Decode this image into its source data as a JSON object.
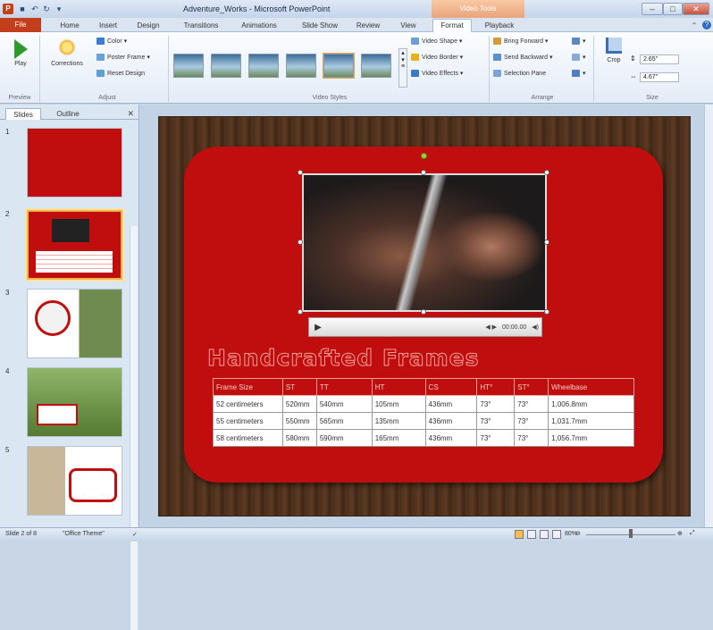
{
  "window": {
    "title": "Adventure_Works - Microsoft PowerPoint",
    "context_tab": "Video Tools",
    "app_icon": "P",
    "quick_access": [
      "save-icon",
      "undo-icon",
      "redo-icon",
      "customize-icon"
    ],
    "controls": [
      "minimize",
      "maximize",
      "close"
    ]
  },
  "tabs": {
    "file": "File",
    "items": [
      "Home",
      "Insert",
      "Design",
      "Transitions",
      "Animations",
      "Slide Show",
      "Review",
      "View",
      "Format",
      "Playback"
    ]
  },
  "ribbon": {
    "preview": {
      "play_label": "Play",
      "group": "Preview"
    },
    "adjust": {
      "corrections_label": "Corrections",
      "color_label": "Color ▾",
      "poster_frame_label": "Poster Frame ▾",
      "reset_design_label": "Reset Design",
      "group": "Adjust"
    },
    "video_styles": {
      "group": "Video Styles",
      "video_shape_label": "Video Shape ▾",
      "video_border_label": "Video Border ▾",
      "video_effects_label": "Video Effects ▾"
    },
    "arrange": {
      "bring_forward_label": "Bring Forward ▾",
      "send_backward_label": "Send Backward ▾",
      "selection_pane_label": "Selection Pane",
      "group": "Arrange"
    },
    "size": {
      "crop_label": "Crop",
      "height": "2.65\"",
      "width": "4.67\"",
      "group": "Size"
    }
  },
  "slides_panel": {
    "tab_slides": "Slides",
    "tab_outline": "Outline",
    "numbers": [
      "1",
      "2",
      "3",
      "4",
      "5"
    ],
    "selected_index": 2
  },
  "slide": {
    "heading": "Handcrafted Frames",
    "video_time": "00:00.00",
    "table": {
      "headers": [
        "Frame Size",
        "ST",
        "TT",
        "HT",
        "CS",
        "HT°",
        "ST°",
        "Wheelbase"
      ],
      "rows": [
        [
          "52 centimeters",
          "520mm",
          "540mm",
          "105mm",
          "436mm",
          "73°",
          "73°",
          "1,006.8mm"
        ],
        [
          "55 centimeters",
          "550mm",
          "565mm",
          "135mm",
          "436mm",
          "73°",
          "73°",
          "1,031.7mm"
        ],
        [
          "58 centimeters",
          "580mm",
          "590mm",
          "165mm",
          "436mm",
          "73°",
          "73°",
          "1,056.7mm"
        ]
      ]
    }
  },
  "status": {
    "slide_info": "Slide 2 of 8",
    "theme": "\"Office Theme\"",
    "zoom": "80%"
  },
  "colors": {
    "slide_red": "#c00d0d",
    "file_tab": "#c33e1c",
    "context_tab": "#e9a47a"
  }
}
